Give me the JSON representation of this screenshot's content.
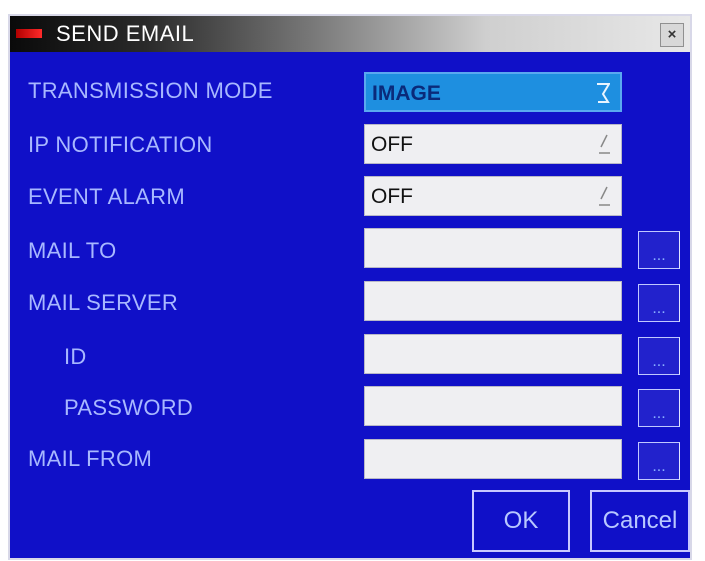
{
  "dialog": {
    "title": "SEND EMAIL",
    "close_label": "×"
  },
  "rows": [
    {
      "label": "TRANSMISSION MODE",
      "value": "IMAGE"
    },
    {
      "label": "IP NOTIFICATION",
      "value": "OFF"
    },
    {
      "label": "EVENT ALARM",
      "value": "OFF"
    },
    {
      "label": "MAIL TO",
      "value": ""
    },
    {
      "label": "MAIL SERVER",
      "value": ""
    },
    {
      "label": "ID",
      "value": ""
    },
    {
      "label": "PASSWORD",
      "value": ""
    },
    {
      "label": "MAIL FROM",
      "value": ""
    }
  ],
  "browse_label": "...",
  "buttons": {
    "ok": "OK",
    "cancel": "Cancel"
  },
  "colors": {
    "background": "#1010c8",
    "label": "#a8b8ff",
    "selected": "#1e8fe0"
  }
}
